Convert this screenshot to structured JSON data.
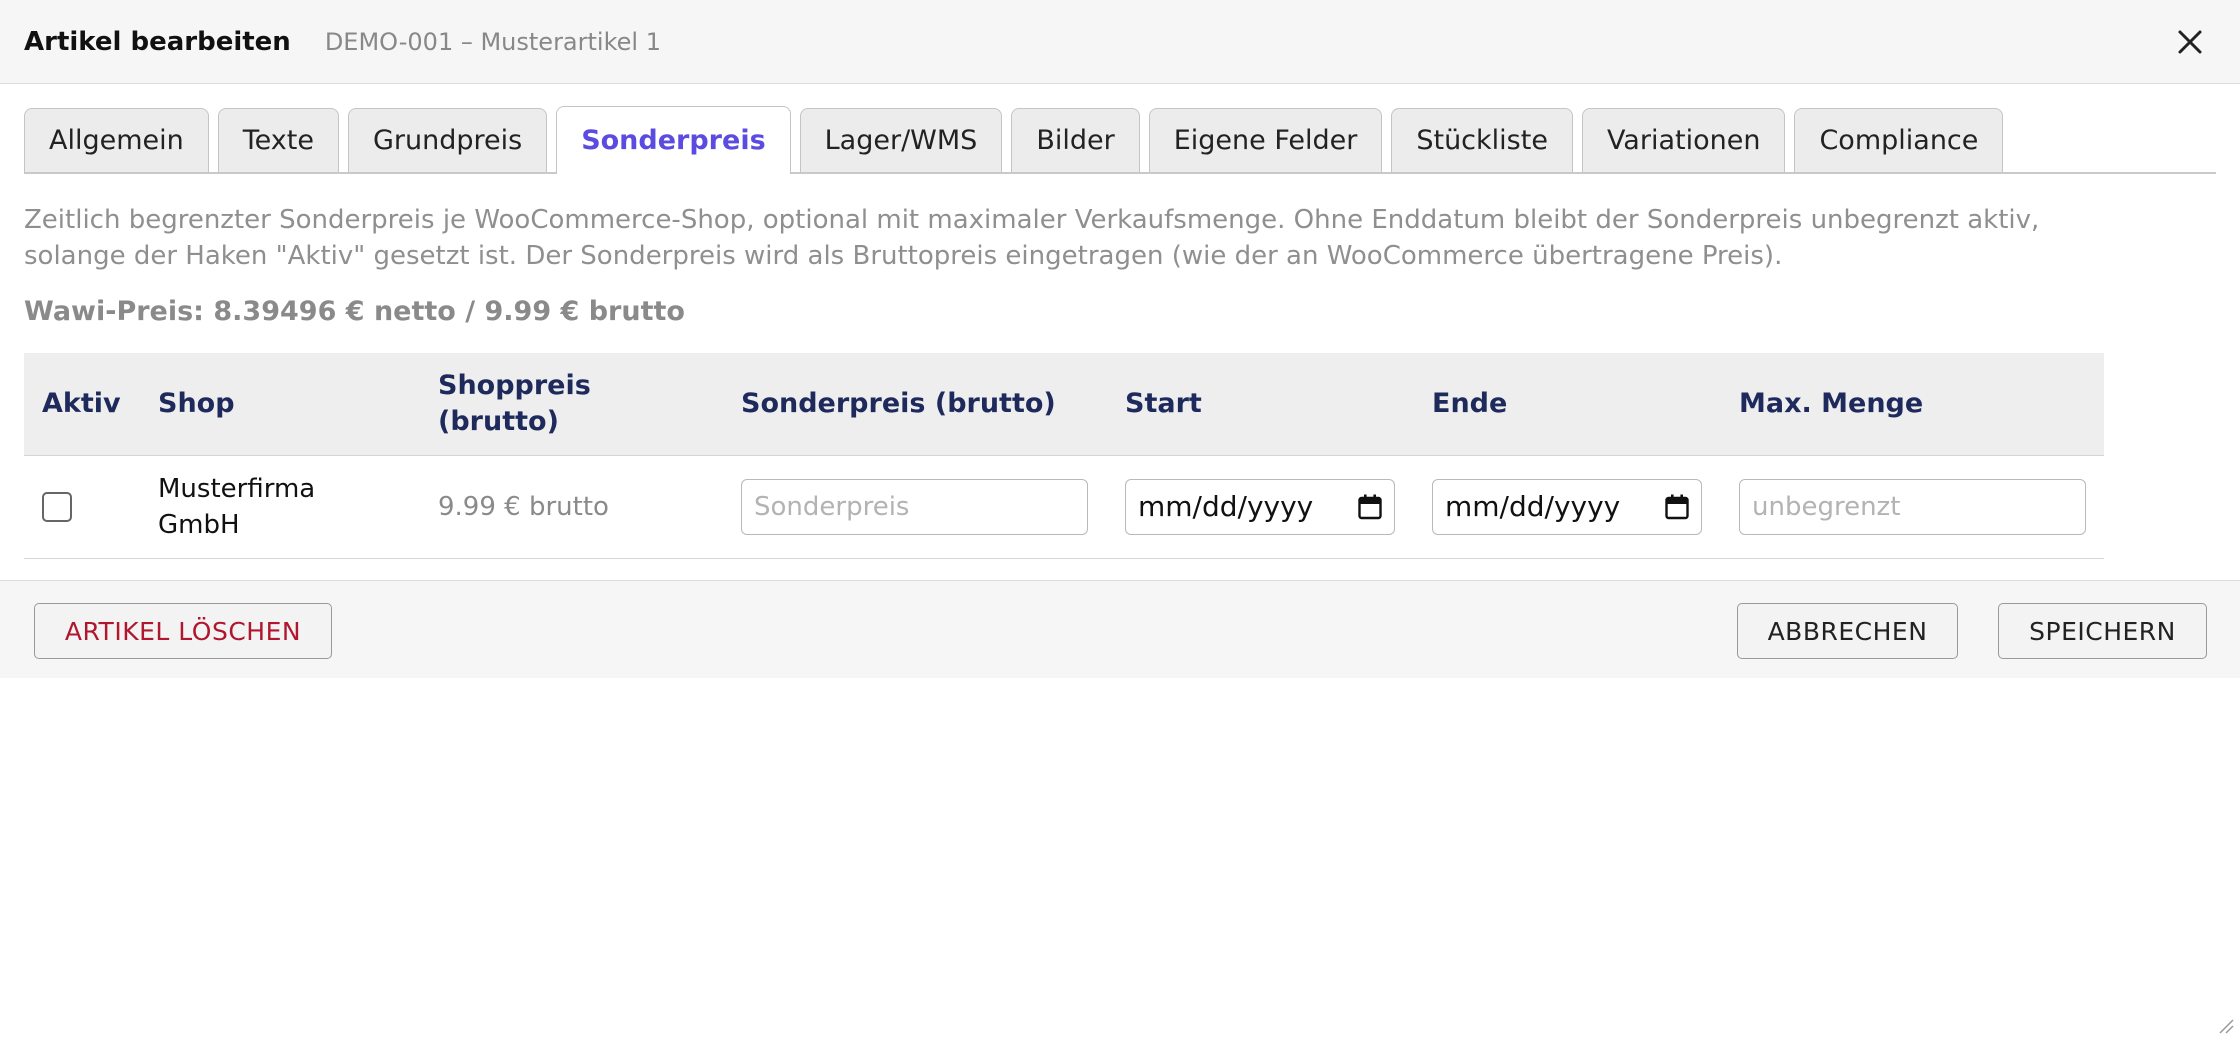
{
  "dialog": {
    "title": "Artikel bearbeiten",
    "subtitle": "DEMO-001 – Musterartikel 1",
    "close_icon": "close-icon"
  },
  "tabs": [
    {
      "label": "Allgemein",
      "active": false
    },
    {
      "label": "Texte",
      "active": false
    },
    {
      "label": "Grundpreis",
      "active": false
    },
    {
      "label": "Sonderpreis",
      "active": true
    },
    {
      "label": "Lager/WMS",
      "active": false
    },
    {
      "label": "Bilder",
      "active": false
    },
    {
      "label": "Eigene Felder",
      "active": false
    },
    {
      "label": "Stückliste",
      "active": false
    },
    {
      "label": "Variationen",
      "active": false
    },
    {
      "label": "Compliance",
      "active": false
    }
  ],
  "content": {
    "description_line1": "Zeitlich begrenzter Sonderpreis je WooCommerce-Shop, optional mit maximaler Verkaufsmenge. Ohne Enddatum bleibt der Sonderpreis unbegrenzt aktiv,",
    "description_line2": "solange der Haken \"Aktiv\" gesetzt ist. Der Sonderpreis wird als Bruttopreis eingetragen (wie der an WooCommerce übertragene Preis).",
    "wawi_price": "Wawi-Preis: 8.39496 € netto / 9.99 € brutto"
  },
  "table": {
    "headers": {
      "active": "Aktiv",
      "shop": "Shop",
      "shop_price_line1": "Shoppreis",
      "shop_price_line2": "(brutto)",
      "special_price": "Sonderpreis (brutto)",
      "start": "Start",
      "end": "Ende",
      "max_qty": "Max. Menge"
    },
    "rows": [
      {
        "active": false,
        "shop_line1": "Musterfirma",
        "shop_line2": "GmbH",
        "shop_price": "9.99 € brutto",
        "special_price_placeholder": "Sonderpreis",
        "start_value": "mm/dd/yyyy",
        "end_value": "mm/dd/yyyy",
        "max_qty_placeholder": "unbegrenzt"
      }
    ]
  },
  "footer": {
    "delete_label": "ARTIKEL LÖSCHEN",
    "cancel_label": "ABBRECHEN",
    "save_label": "SPEICHERN"
  },
  "colors": {
    "accent": "#5b4be0",
    "header_text": "#1f2a5c",
    "danger": "#b0172f"
  }
}
